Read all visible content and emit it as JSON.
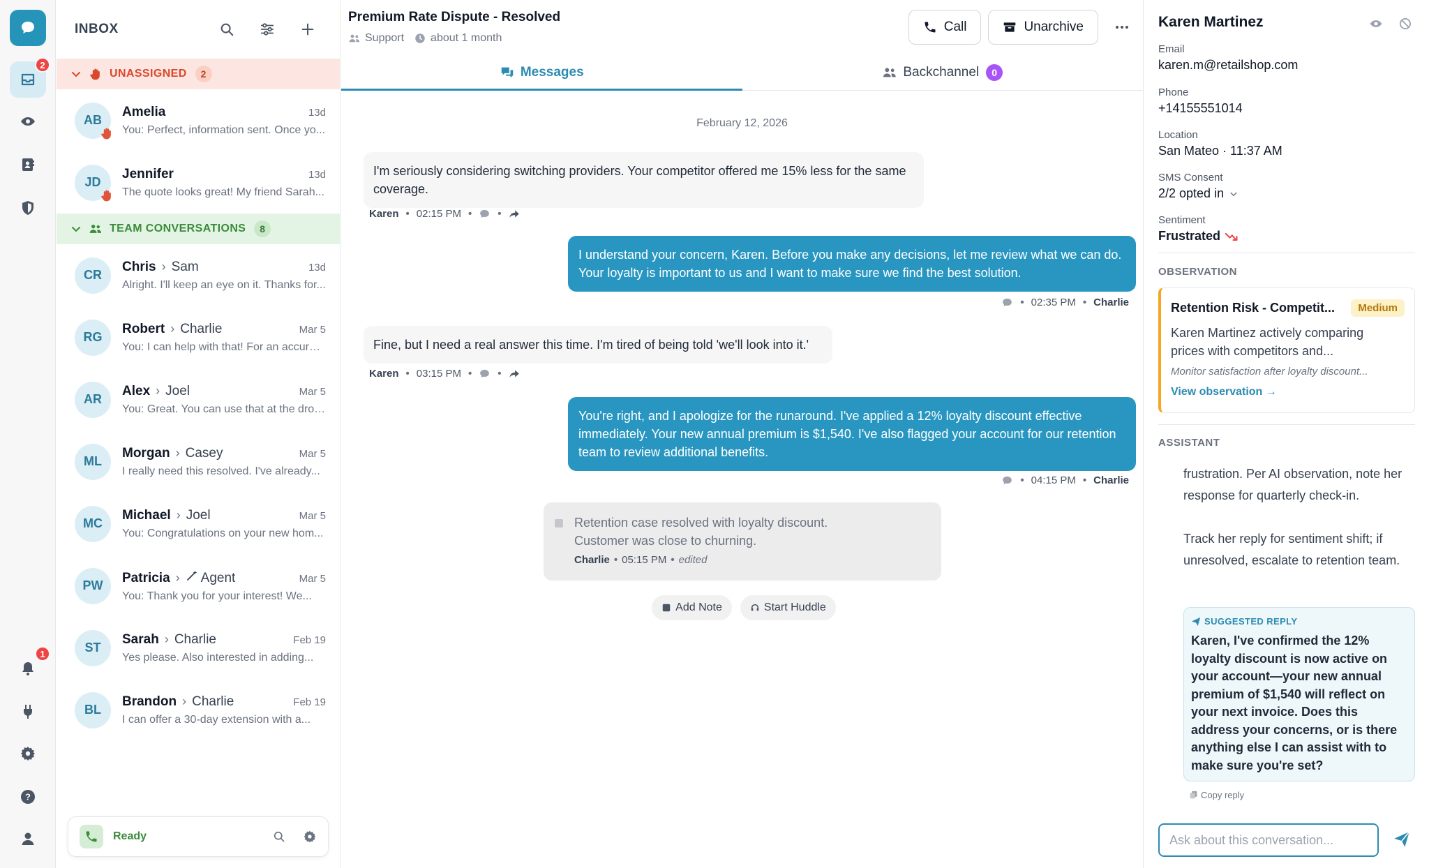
{
  "colors": {
    "accent": "#2896c0",
    "unassigned": "#d9482b",
    "team": "#3b8a3b",
    "badge": "#ef4444",
    "medium": "#f5a623",
    "backchannel_count": "#a855f7"
  },
  "rail": {
    "inbox_badge": "2",
    "bell_badge": "1",
    "icons": [
      "chat-logo-icon",
      "inbox-icon",
      "eye-icon",
      "contacts-icon",
      "shield-icon",
      "bell-icon",
      "plug-icon",
      "gear-icon",
      "help-icon",
      "user-icon"
    ]
  },
  "inbox": {
    "title": "INBOX",
    "unassigned": {
      "label": "UNASSIGNED",
      "count": "2"
    },
    "team": {
      "label": "TEAM CONVERSATIONS",
      "count": "8"
    },
    "conversations": [
      {
        "initials": "AB",
        "name": "Amelia",
        "to": "",
        "date": "13d",
        "preview": "You: Perfect, information sent. Once yo..."
      },
      {
        "initials": "JD",
        "name": "Jennifer",
        "to": "",
        "date": "13d",
        "preview": "The quote looks great! My friend Sarah..."
      },
      {
        "initials": "CR",
        "name": "Chris",
        "to": "Sam",
        "date": "13d",
        "preview": "Alright. I'll keep an eye on it. Thanks for..."
      },
      {
        "initials": "RG",
        "name": "Robert",
        "to": "Charlie",
        "date": "Mar 5",
        "preview": "You: I can help with that! For an accurat..."
      },
      {
        "initials": "AR",
        "name": "Alex",
        "to": "Joel",
        "date": "Mar 5",
        "preview": "You: Great. You can use that at the drop..."
      },
      {
        "initials": "ML",
        "name": "Morgan",
        "to": "Casey",
        "date": "Mar 5",
        "preview": "I really need this resolved. I've already..."
      },
      {
        "initials": "MC",
        "name": "Michael",
        "to": "Joel",
        "date": "Mar 5",
        "preview": "You: Congratulations on your new hom..."
      },
      {
        "initials": "PW",
        "name": "Patricia",
        "to": "Agent",
        "date": "Mar 5",
        "preview": "You: Thank you for your interest! We..."
      },
      {
        "initials": "ST",
        "name": "Sarah",
        "to": "Charlie",
        "date": "Feb 19",
        "preview": "Yes please. Also interested in adding..."
      },
      {
        "initials": "BL",
        "name": "Brandon",
        "to": "Charlie",
        "date": "Feb 19",
        "preview": "I can offer a 30-day extension with a..."
      }
    ],
    "status": "Ready"
  },
  "conversation": {
    "title": "Premium Rate Dispute - Resolved",
    "team": "Support",
    "age": "about 1 month",
    "call_label": "Call",
    "unarchive_label": "Unarchive",
    "tabs": {
      "messages": "Messages",
      "backchannel": "Backchannel",
      "backchannel_count": "0"
    },
    "date": "February 12, 2026",
    "messages": [
      {
        "text": "I'm seriously considering switching providers. Your competitor offered me 15% less for the same coverage.",
        "author": "Karen",
        "time": "02:15 PM"
      },
      {
        "text": "I understand your concern, Karen. Before you make any decisions, let me review what we can do. Your loyalty is important to us and I want to make sure we find the best solution.",
        "author": "Charlie",
        "time": "02:35 PM"
      },
      {
        "text": "Fine, but I need a real answer this time. I'm tired of being told 'we'll look into it.'",
        "author": "Karen",
        "time": "03:15 PM"
      },
      {
        "text": "You're right, and I apologize for the runaround. I've applied a 12% loyalty discount effective immediately. Your new annual premium is $1,540. I've also flagged your account for our retention team to review additional benefits.",
        "author": "Charlie",
        "time": "04:15 PM"
      }
    ],
    "note": {
      "line1": "Retention case resolved with loyalty discount.",
      "line2": "Customer was close to churning.",
      "author": "Charlie",
      "time": "05:15 PM",
      "edited": "edited"
    },
    "add_note": "Add Note",
    "start_huddle": "Start Huddle"
  },
  "contact": {
    "name": "Karen Martinez",
    "email_label": "Email",
    "email": "karen.m@retailshop.com",
    "phone_label": "Phone",
    "phone": "+14155551014",
    "location_label": "Location",
    "location": "San Mateo · 11:37 AM",
    "sms_label": "SMS Consent",
    "sms": "2/2 opted in",
    "sentiment_label": "Sentiment",
    "sentiment": "Frustrated",
    "observation_heading": "OBSERVATION",
    "observation": {
      "title": "Retention Risk - Competit...",
      "severity": "Medium",
      "description_1": "Karen Martinez actively comparing",
      "description_2": "prices with competitors and...",
      "hint": "Monitor satisfaction after loyalty discount...",
      "link": "View observation →"
    },
    "assistant_heading": "ASSISTANT",
    "assistant_p1": "frustration. Per AI observation, note her response for quarterly check-in.",
    "assistant_p2": "Track her reply for sentiment shift; if unresolved, escalate to retention team.",
    "suggested_label": "SUGGESTED REPLY",
    "suggested_text": "Karen, I've confirmed the 12% loyalty discount is now active on your account—your new annual premium of $1,540 will reflect on your next invoice. Does this address your concerns, or is there anything else I can assist with to make sure you're set?",
    "copy_label": "Copy reply",
    "ask_placeholder": "Ask about this conversation..."
  }
}
